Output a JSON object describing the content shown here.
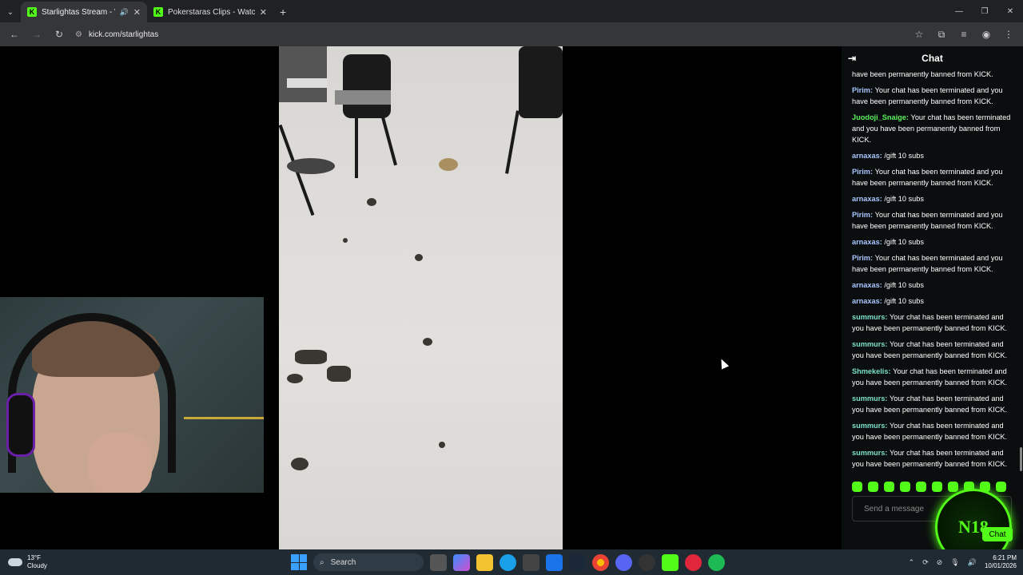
{
  "browser": {
    "tabs": [
      {
        "title": "Starlightas Stream - Watch",
        "active": true
      },
      {
        "title": "Pokerstaras Clips - Watch Live",
        "active": false
      }
    ],
    "url": "kick.com/starlightas"
  },
  "chat": {
    "title": "Chat",
    "top_partial": "have been permanently banned from KICK.",
    "messages": [
      {
        "user": "Pirim",
        "color": "#a8c7ff",
        "text": "Your chat has been terminated and you have been permanently banned from KICK."
      },
      {
        "user": "Juodoji_Snaige",
        "color": "#5cf25c",
        "text": "Your chat has been terminated and you have been permanently banned from KICK."
      },
      {
        "user": "arnaxas",
        "color": "#a8c7ff",
        "text": "/gift 10 subs"
      },
      {
        "user": "Pirim",
        "color": "#a8c7ff",
        "text": "Your chat has been terminated and you have been permanently banned from KICK."
      },
      {
        "user": "arnaxas",
        "color": "#a8c7ff",
        "text": "/gift 10 subs"
      },
      {
        "user": "Pirim",
        "color": "#a8c7ff",
        "text": "Your chat has been terminated and you have been permanently banned from KICK."
      },
      {
        "user": "arnaxas",
        "color": "#a8c7ff",
        "text": "/gift 10 subs"
      },
      {
        "user": "Pirim",
        "color": "#a8c7ff",
        "text": "Your chat has been terminated and you have been permanently banned from KICK."
      },
      {
        "user": "arnaxas",
        "color": "#a8c7ff",
        "text": "/gift 10 subs"
      },
      {
        "user": "arnaxas",
        "color": "#a8c7ff",
        "text": "/gift 10 subs"
      },
      {
        "user": "summurs",
        "color": "#7be0c8",
        "text": "Your chat has been terminated and you have been permanently banned from KICK."
      },
      {
        "user": "summurs",
        "color": "#7be0c8",
        "text": "Your chat has been terminated and you have been permanently banned from KICK."
      },
      {
        "user": "Shmekelis",
        "color": "#7be0c8",
        "text": "Your chat has been terminated and you have been permanently banned from KICK."
      },
      {
        "user": "summurs",
        "color": "#7be0c8",
        "text": "Your chat has been terminated and you have been permanently banned from KICK."
      },
      {
        "user": "summurs",
        "color": "#7be0c8",
        "text": "Your chat has been terminated and you have been permanently banned from KICK."
      },
      {
        "user": "summurs",
        "color": "#7be0c8",
        "text": "Your chat has been terminated and you have been permanently banned from KICK."
      }
    ],
    "input_placeholder": "Send a message",
    "chat_button": "Chat",
    "badge_text": "N18"
  },
  "taskbar": {
    "weather_temp": "13°F",
    "weather_desc": "Cloudy",
    "search_label": "Search",
    "time": "6:21 PM",
    "date": "10/01/2026"
  },
  "colors": {
    "kick_green": "#53fc18"
  }
}
